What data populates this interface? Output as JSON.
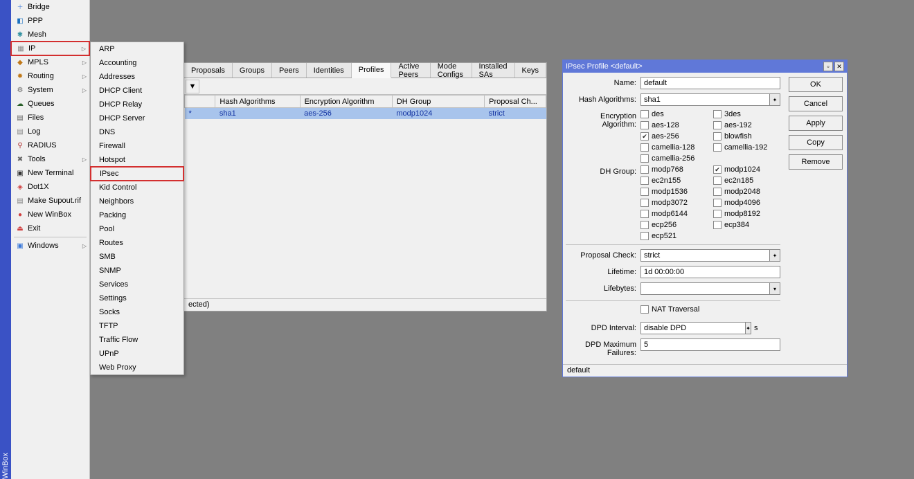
{
  "app_label": "WinBox",
  "sidebar": {
    "items": [
      {
        "label": "Bridge",
        "icon": "🞢",
        "color": "#3a78d8"
      },
      {
        "label": "PPP",
        "icon": "◧",
        "color": "#1a70c0"
      },
      {
        "label": "Mesh",
        "icon": "✱",
        "color": "#3090a0"
      },
      {
        "label": "IP",
        "icon": "▦",
        "color": "#888",
        "arrow": true,
        "highlight": true
      },
      {
        "label": "MPLS",
        "icon": "◆",
        "color": "#c07818",
        "arrow": true
      },
      {
        "label": "Routing",
        "icon": "✹",
        "color": "#c07818",
        "arrow": true
      },
      {
        "label": "System",
        "icon": "⚙",
        "color": "#666",
        "arrow": true
      },
      {
        "label": "Queues",
        "icon": "☁",
        "color": "#2a602a"
      },
      {
        "label": "Files",
        "icon": "▤",
        "color": "#666"
      },
      {
        "label": "Log",
        "icon": "▤",
        "color": "#888"
      },
      {
        "label": "RADIUS",
        "icon": "⚲",
        "color": "#b03030"
      },
      {
        "label": "Tools",
        "icon": "✖",
        "color": "#666",
        "arrow": true
      },
      {
        "label": "New Terminal",
        "icon": "▣",
        "color": "#333"
      },
      {
        "label": "Dot1X",
        "icon": "◈",
        "color": "#d04040"
      },
      {
        "label": "Make Supout.rif",
        "icon": "▤",
        "color": "#888"
      },
      {
        "label": "New WinBox",
        "icon": "●",
        "color": "#d04040"
      },
      {
        "label": "Exit",
        "icon": "⏏",
        "color": "#d04040"
      },
      {
        "sep": true
      },
      {
        "label": "Windows",
        "icon": "▣",
        "color": "#3a78d8",
        "arrow": true
      }
    ]
  },
  "ip_submenu": {
    "items": [
      {
        "label": "ARP"
      },
      {
        "label": "Accounting"
      },
      {
        "label": "Addresses"
      },
      {
        "label": "DHCP Client"
      },
      {
        "label": "DHCP Relay"
      },
      {
        "label": "DHCP Server"
      },
      {
        "label": "DNS"
      },
      {
        "label": "Firewall"
      },
      {
        "label": "Hotspot"
      },
      {
        "label": "IPsec",
        "highlight": true
      },
      {
        "label": "Kid Control"
      },
      {
        "label": "Neighbors"
      },
      {
        "label": "Packing"
      },
      {
        "label": "Pool"
      },
      {
        "label": "Routes"
      },
      {
        "label": "SMB"
      },
      {
        "label": "SNMP"
      },
      {
        "label": "Services"
      },
      {
        "label": "Settings"
      },
      {
        "label": "Socks"
      },
      {
        "label": "TFTP"
      },
      {
        "label": "Traffic Flow"
      },
      {
        "label": "UPnP"
      },
      {
        "label": "Web Proxy"
      }
    ]
  },
  "ipsec": {
    "tabs": [
      "Proposals",
      "Groups",
      "Peers",
      "Identities",
      "Profiles",
      "Active Peers",
      "Mode Configs",
      "Installed SAs",
      "Keys"
    ],
    "active_tab": "Profiles",
    "columns": [
      "",
      "Hash Algorithms",
      "Encryption Algorithm",
      "DH Group",
      "Proposal Ch..."
    ],
    "row_marker": "*",
    "rows": [
      {
        "marker": "*",
        "hash": "sha1",
        "enc": "aes-256",
        "dh": "modp1024",
        "pc": "strict"
      }
    ],
    "status_suffix": "ected)"
  },
  "dialog": {
    "title": "IPsec Profile <default>",
    "labels": {
      "name": "Name:",
      "hash": "Hash Algorithms:",
      "enc": "Encryption Algorithm:",
      "dh": "DH Group:",
      "pc": "Proposal Check:",
      "lifetime": "Lifetime:",
      "lifebytes": "Lifebytes:",
      "nat": "NAT Traversal",
      "dpd_int": "DPD Interval:",
      "dpd_max": "DPD Maximum Failures:"
    },
    "values": {
      "name": "default",
      "hash": "sha1",
      "pc": "strict",
      "lifetime": "1d 00:00:00",
      "lifebytes": "",
      "dpd_int": "disable DPD",
      "dpd_int_unit": "s",
      "dpd_max": "5"
    },
    "enc_opts": [
      {
        "label": "des",
        "checked": false
      },
      {
        "label": "3des",
        "checked": false
      },
      {
        "label": "aes-128",
        "checked": false
      },
      {
        "label": "aes-192",
        "checked": false
      },
      {
        "label": "aes-256",
        "checked": true
      },
      {
        "label": "blowfish",
        "checked": false
      },
      {
        "label": "camellia-128",
        "checked": false
      },
      {
        "label": "camellia-192",
        "checked": false
      },
      {
        "label": "camellia-256",
        "checked": false
      }
    ],
    "dh_opts": [
      {
        "label": "modp768",
        "checked": false
      },
      {
        "label": "modp1024",
        "checked": true
      },
      {
        "label": "ec2n155",
        "checked": false
      },
      {
        "label": "ec2n185",
        "checked": false
      },
      {
        "label": "modp1536",
        "checked": false
      },
      {
        "label": "modp2048",
        "checked": false
      },
      {
        "label": "modp3072",
        "checked": false
      },
      {
        "label": "modp4096",
        "checked": false
      },
      {
        "label": "modp6144",
        "checked": false
      },
      {
        "label": "modp8192",
        "checked": false
      },
      {
        "label": "ecp256",
        "checked": false
      },
      {
        "label": "ecp384",
        "checked": false
      },
      {
        "label": "ecp521",
        "checked": false
      }
    ],
    "nat_checked": false,
    "buttons": [
      "OK",
      "Cancel",
      "Apply",
      "Copy",
      "Remove"
    ],
    "status": "default"
  }
}
